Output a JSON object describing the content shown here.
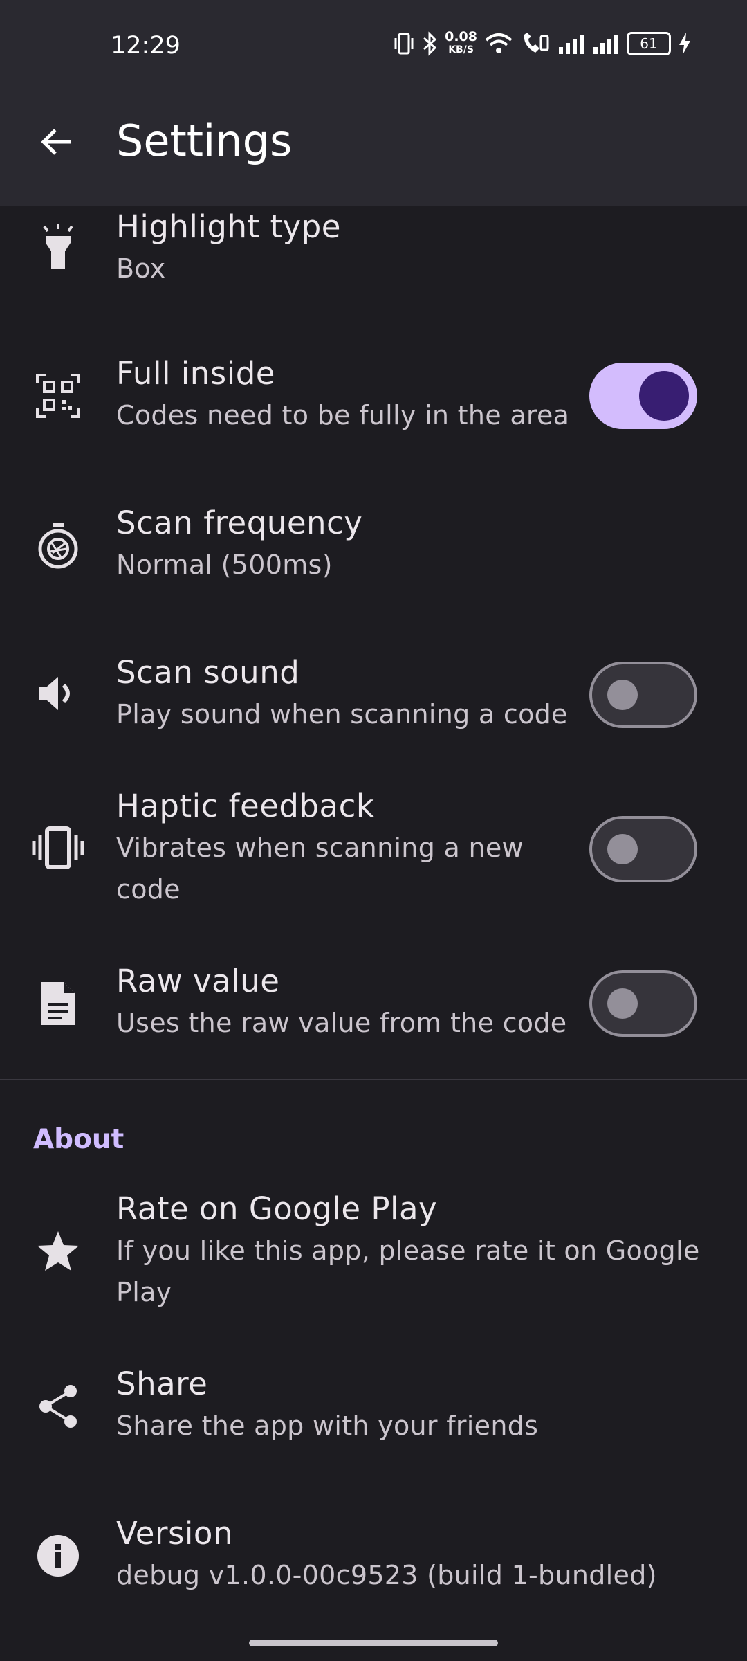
{
  "status_bar": {
    "time": "12:29",
    "net_speed_value": "0.08",
    "net_speed_unit": "KB/S",
    "battery": "61"
  },
  "app_bar": {
    "title": "Settings"
  },
  "settings": [
    {
      "title": "Highlight type",
      "subtitle": "Box",
      "icon": "flashlight-icon"
    },
    {
      "title": "Full inside",
      "subtitle": "Codes need to be fully in the area",
      "icon": "qr-code-icon",
      "switch": true
    },
    {
      "title": "Scan frequency",
      "subtitle": "Normal (500ms)",
      "icon": "shutter-timer-icon"
    },
    {
      "title": "Scan sound",
      "subtitle": "Play sound when scanning a code",
      "icon": "speaker-icon",
      "switch": false
    },
    {
      "title": "Haptic feedback",
      "subtitle_line1": "Vibrates when scanning a new",
      "subtitle_line2": "code",
      "icon": "vibrate-icon",
      "switch": false
    },
    {
      "title": "Raw value",
      "subtitle": "Uses the raw value from the code",
      "icon": "document-icon",
      "switch": false
    }
  ],
  "about": {
    "header": "About",
    "items": [
      {
        "title": "Rate on Google Play",
        "subtitle_line1": "If you like this app, please rate it on Google",
        "subtitle_line2": "Play",
        "icon": "star-icon"
      },
      {
        "title": "Share",
        "subtitle": "Share the app with your friends",
        "icon": "share-icon"
      },
      {
        "title": "Version",
        "subtitle": "debug v1.0.0-00c9523 (build 1-bundled)",
        "icon": "info-icon"
      }
    ]
  },
  "colors": {
    "accent": "#d0bcff",
    "background": "#1d1c21",
    "app_bar": "#2a2930"
  }
}
